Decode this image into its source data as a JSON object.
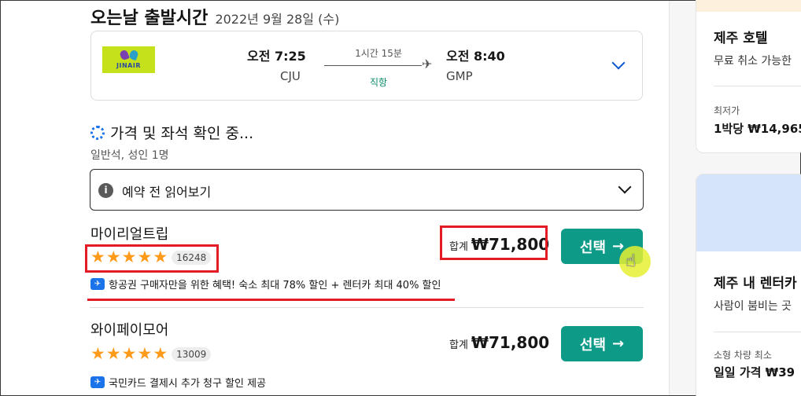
{
  "header": {
    "title": "오는날 출발시간",
    "date": "2022년 9월 28일 (수)"
  },
  "flight": {
    "airline_logo_text": "JINAIR",
    "departure_time": "오전 7:25",
    "departure_code": "CJU",
    "duration": "1시간 15분",
    "stops": "직항",
    "arrival_time": "오전 8:40",
    "arrival_code": "GMP"
  },
  "loading": {
    "text": "가격 및 좌석 확인 중...",
    "seat_info": "일반석, 성인 1명"
  },
  "readme": {
    "label": "예약 전 읽어보기"
  },
  "offers": [
    {
      "agency": "마이리얼트립",
      "rating_stars": 5,
      "review_count": "16248",
      "benefit": "항공권 구매자만을 위한 혜택! 숙소 최대 78% 할인 + 렌터카 최대 40% 할인",
      "price_label": "합계",
      "price": "₩71,800",
      "button_label": "선택"
    },
    {
      "agency": "와이페이모어",
      "rating_stars": 5,
      "review_count": "13009",
      "benefit": "국민카드 결제시 추가 청구 할인 제공",
      "price_label": "합계",
      "price": "₩71,800",
      "button_label": "선택"
    }
  ],
  "sidebar": {
    "hotel": {
      "title": "제주 호텔",
      "subtitle": "무료 취소 가능한",
      "price_caption": "최저가",
      "price": "1박당 ₩14,965"
    },
    "car": {
      "title": "제주 내 렌터카",
      "subtitle": "사람이 붐비는 곳",
      "price_caption": "소형 차량 최소",
      "price": "일일 가격 ₩39"
    }
  },
  "colors": {
    "accent_button": "#0d9a87",
    "annotation_red": "#e31b25",
    "star": "#ff9a1a",
    "link_blue": "#0b57d0"
  },
  "icons": {
    "spinner": "spinner-icon",
    "info": "info-icon",
    "star": "star-icon",
    "promo": "promo-icon",
    "plane": "plane-icon",
    "chevron": "chevron-down-icon",
    "cursor": "hand-cursor-icon"
  }
}
